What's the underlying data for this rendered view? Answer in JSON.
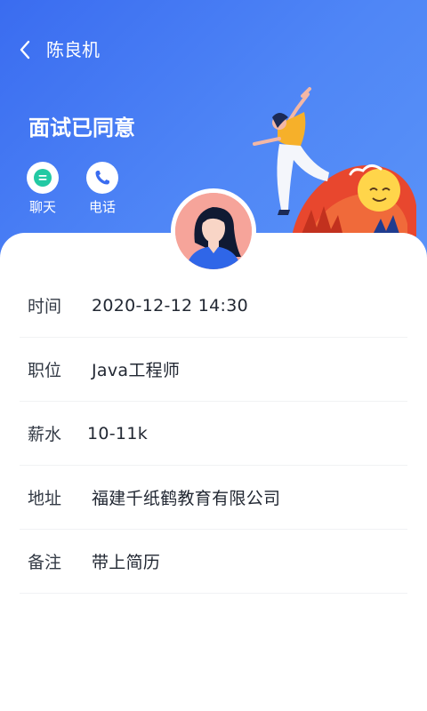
{
  "header": {
    "title": "陈良机",
    "status": "面试已同意"
  },
  "actions": [
    {
      "label": "聊天",
      "icon": "chat-icon"
    },
    {
      "label": "电话",
      "icon": "phone-icon"
    }
  ],
  "details": [
    {
      "key": "时间",
      "value": "2020-12-12 14:30"
    },
    {
      "key": "职位",
      "value": "Java工程师"
    },
    {
      "key": "薪水",
      "value": "10-11k"
    },
    {
      "key": "地址",
      "value": "福建千纸鹤教育有限公司"
    },
    {
      "key": "备注",
      "value": "带上简历"
    }
  ],
  "colors": {
    "accent": "#3a6cf0",
    "chat_icon": "#22c9a3",
    "phone_icon": "#3a6cf0"
  }
}
